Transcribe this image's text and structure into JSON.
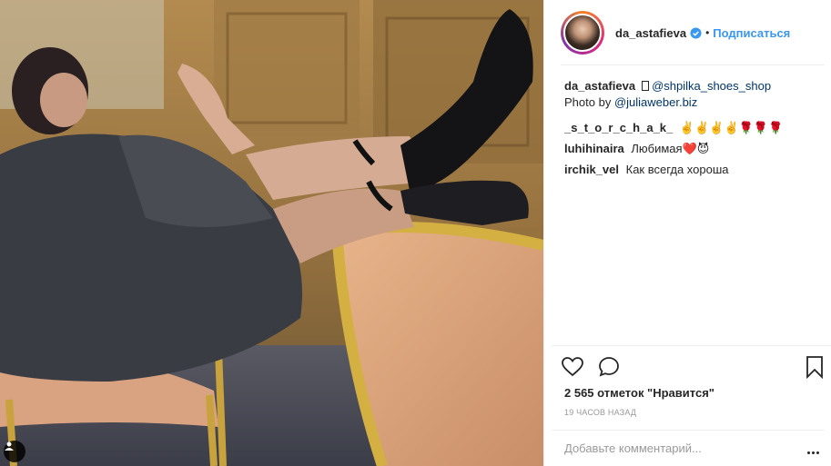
{
  "post": {
    "username": "da_astafieva",
    "follow_label": "Подписаться",
    "dot": "•",
    "verified_icon": "verified-badge-icon",
    "accent_color": "#3897f0"
  },
  "comments": {
    "caption": {
      "user": "da_astafieva",
      "mention_shop": "@shpilka_shoes_shop",
      "line2_prefix": "Photo by",
      "mention_photo": "@juliaweber.biz"
    },
    "c1": {
      "user": "_s_t_o_r_c_h_a_k_",
      "text": "✌️✌️✌️✌️🌹🌹🌹"
    },
    "c2": {
      "user": "luhihinaira",
      "text": "Любимая❤️😈"
    },
    "c3": {
      "user": "irchik_vel",
      "text": "Как всегда хороша"
    }
  },
  "actions": {
    "like_icon": "heart-icon",
    "comment_icon": "comment-bubble-icon",
    "save_icon": "bookmark-icon"
  },
  "likes_text": "2 565 отметок \"Нравится\"",
  "time_text": "19 часов назад",
  "add_comment": {
    "placeholder": "Добавьте комментарий...",
    "more_icon": "more-options-icon"
  }
}
